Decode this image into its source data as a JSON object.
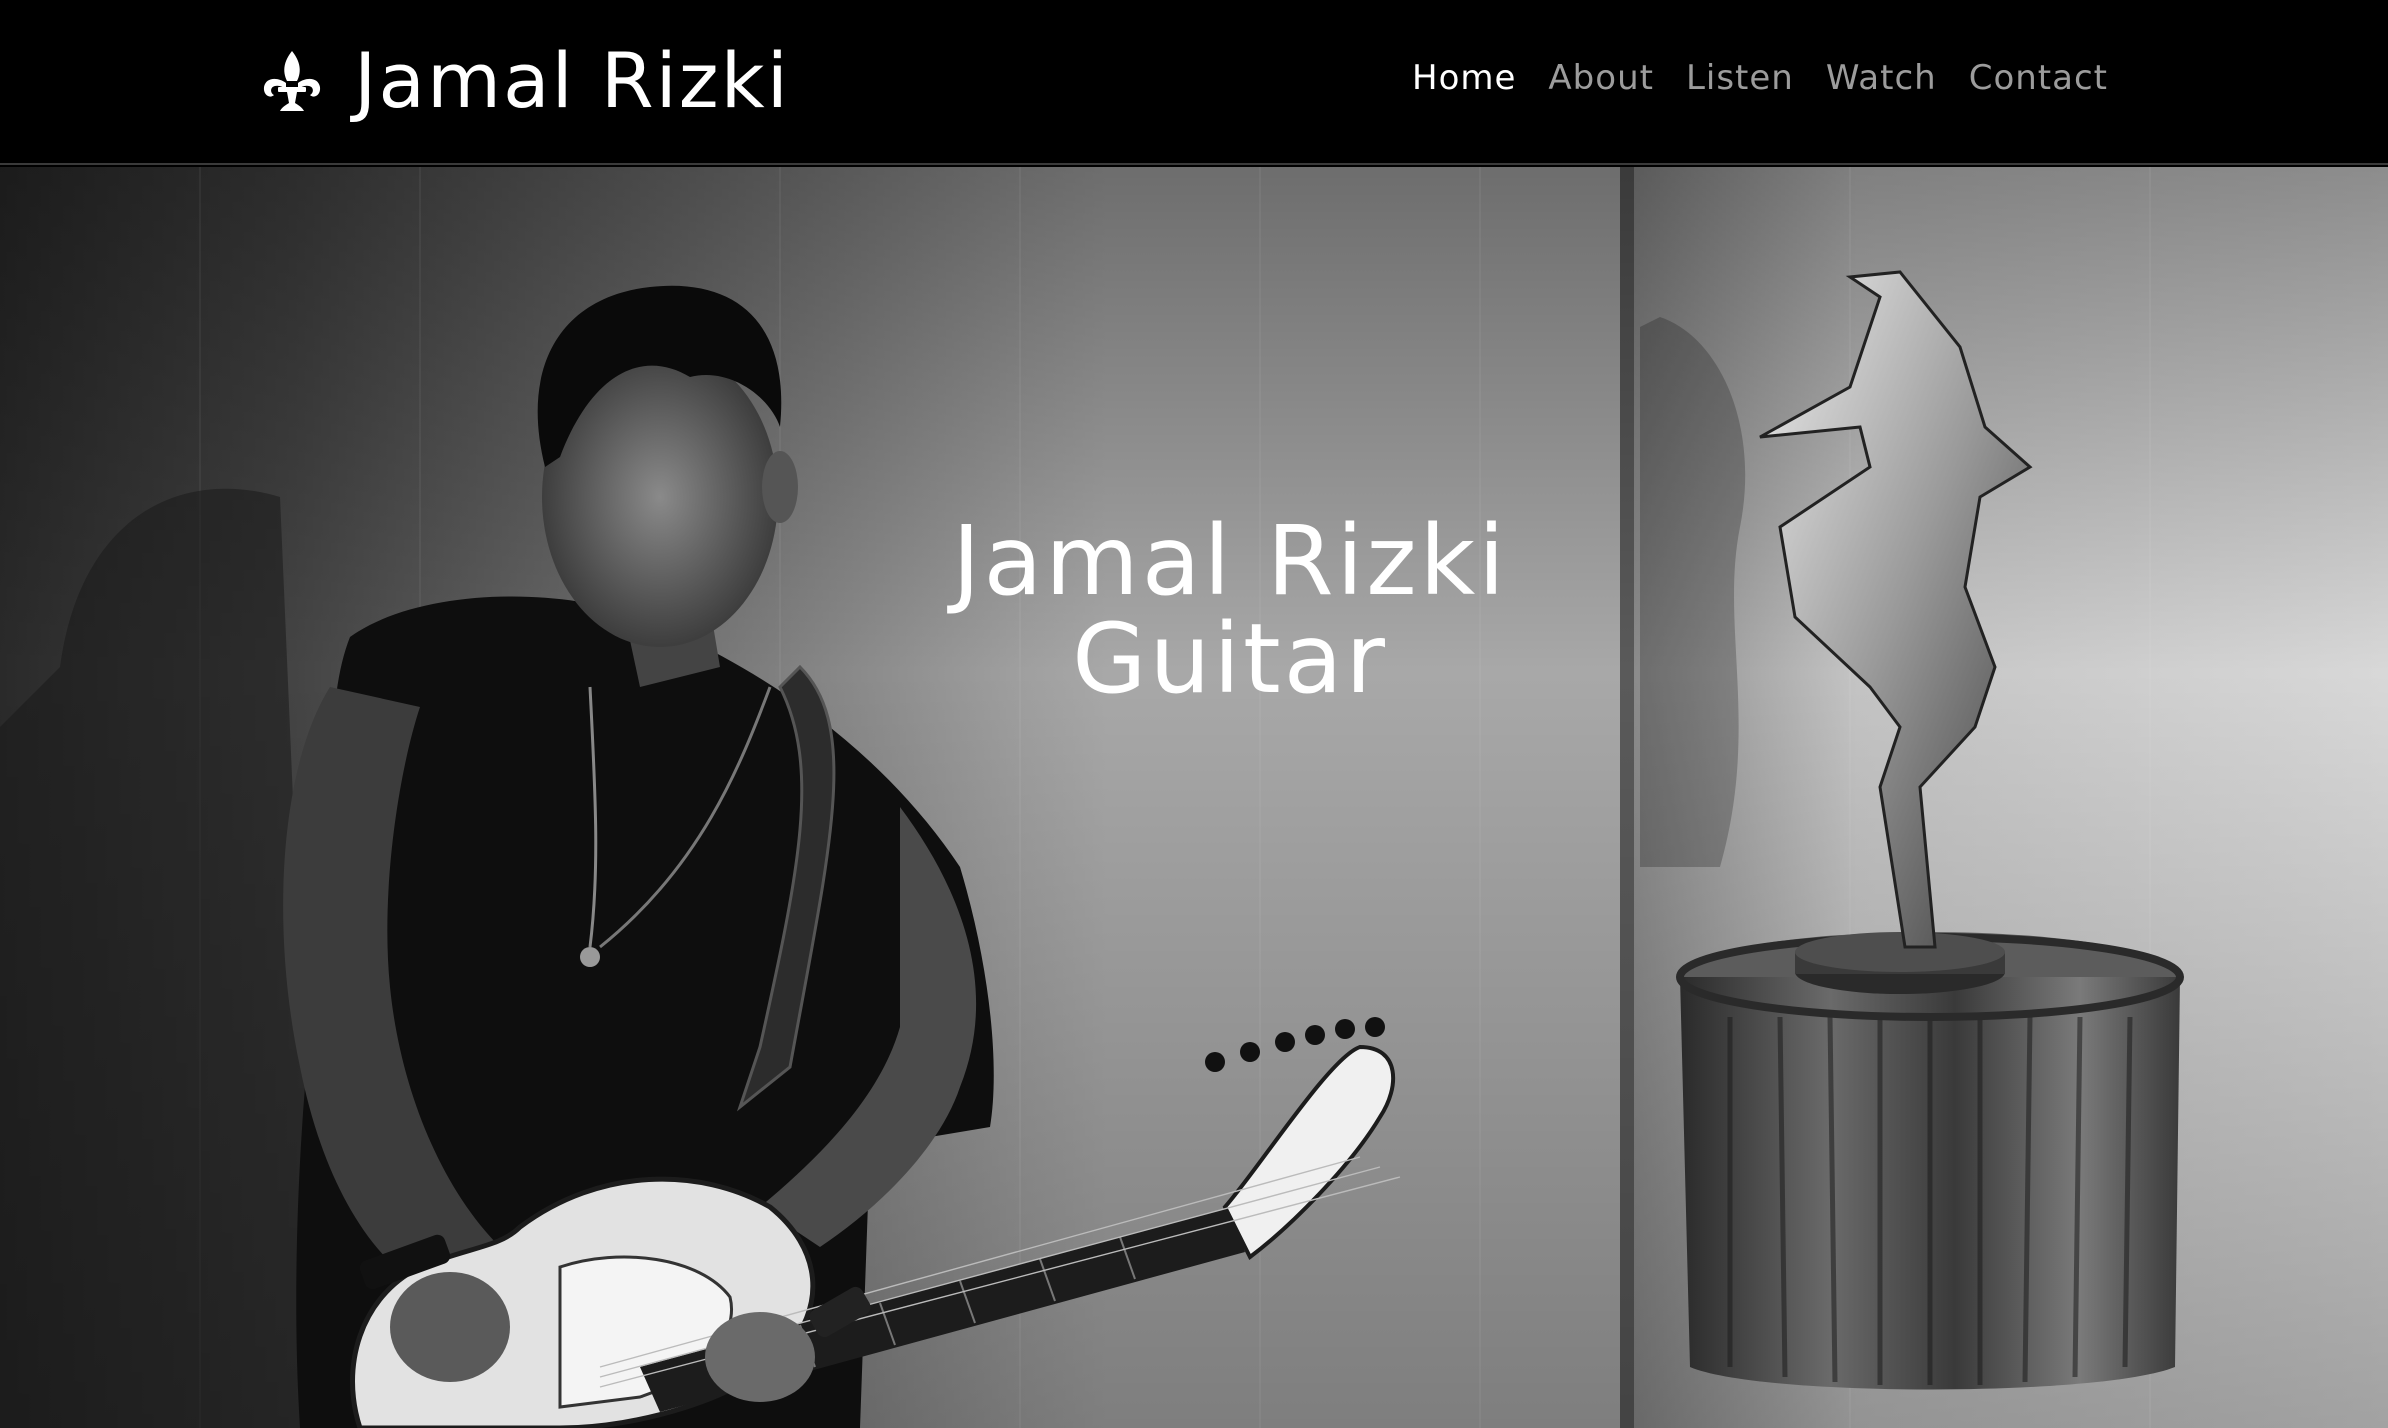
{
  "site": {
    "brand_name": "Jamal Rizki",
    "brand_icon": "fleur-de-lis-icon"
  },
  "nav": {
    "items": [
      {
        "label": "Home",
        "active": true
      },
      {
        "label": "About",
        "active": false
      },
      {
        "label": "Listen",
        "active": false
      },
      {
        "label": "Watch",
        "active": false
      },
      {
        "label": "Contact",
        "active": false
      }
    ]
  },
  "hero": {
    "title_line1": "Jamal Rizki",
    "title_line2": "Guitar"
  },
  "colors": {
    "header_bg": "#000000",
    "nav_active": "#ffffff",
    "nav_inactive": "#9c9c9c",
    "hero_text": "#ffffff"
  }
}
